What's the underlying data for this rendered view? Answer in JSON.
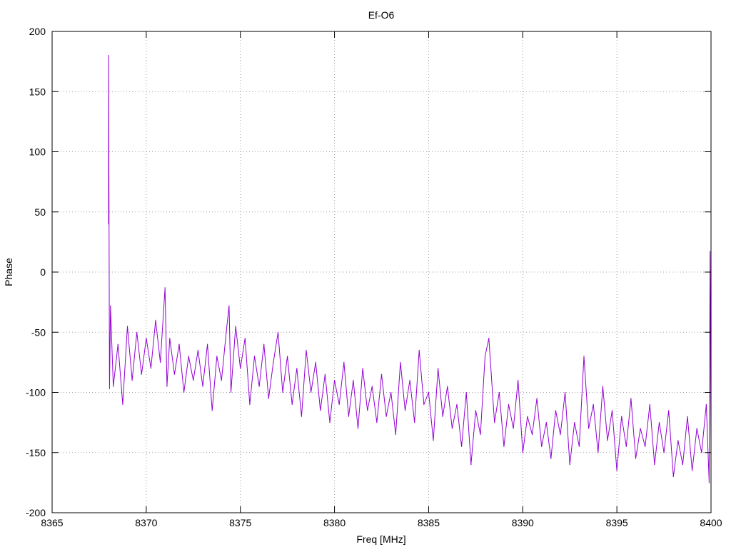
{
  "chart_data": {
    "type": "line",
    "title": "Ef-O6",
    "xlabel": "Freq [MHz]",
    "ylabel": "Phase",
    "xlim": [
      8365,
      8400
    ],
    "ylim": [
      -200,
      200
    ],
    "xticks": [
      8365,
      8370,
      8375,
      8380,
      8385,
      8390,
      8395,
      8400
    ],
    "yticks": [
      -200,
      -150,
      -100,
      -50,
      0,
      50,
      100,
      150,
      200
    ],
    "grid": true,
    "legend": "none",
    "series": [
      {
        "color": "#9400d3",
        "note_sampling": "approximate envelope of the noisy phase trace, sampled every 0.25 MHz",
        "x": [
          8368.0,
          8368.0,
          8368.05,
          8368.1,
          8368.25,
          8368.5,
          8368.75,
          8369.0,
          8369.25,
          8369.5,
          8369.75,
          8370.0,
          8370.25,
          8370.5,
          8370.75,
          8371.0,
          8371.1,
          8371.25,
          8371.5,
          8371.75,
          8372.0,
          8372.25,
          8372.5,
          8372.75,
          8373.0,
          8373.25,
          8373.5,
          8373.75,
          8374.0,
          8374.25,
          8374.4,
          8374.5,
          8374.75,
          8375.0,
          8375.25,
          8375.5,
          8375.75,
          8376.0,
          8376.25,
          8376.5,
          8376.75,
          8377.0,
          8377.25,
          8377.5,
          8377.75,
          8378.0,
          8378.25,
          8378.5,
          8378.75,
          8379.0,
          8379.25,
          8379.5,
          8379.75,
          8380.0,
          8380.25,
          8380.5,
          8380.75,
          8381.0,
          8381.25,
          8381.5,
          8381.75,
          8382.0,
          8382.25,
          8382.5,
          8382.75,
          8383.0,
          8383.25,
          8383.5,
          8383.75,
          8384.0,
          8384.25,
          8384.5,
          8384.75,
          8385.0,
          8385.25,
          8385.5,
          8385.75,
          8386.0,
          8386.25,
          8386.5,
          8386.75,
          8387.0,
          8387.25,
          8387.5,
          8387.75,
          8388.0,
          8388.2,
          8388.5,
          8388.75,
          8389.0,
          8389.25,
          8389.5,
          8389.75,
          8390.0,
          8390.25,
          8390.5,
          8390.75,
          8391.0,
          8391.25,
          8391.5,
          8391.75,
          8392.0,
          8392.25,
          8392.5,
          8392.75,
          8393.0,
          8393.25,
          8393.5,
          8393.75,
          8394.0,
          8394.25,
          8394.5,
          8394.75,
          8395.0,
          8395.25,
          8395.5,
          8395.75,
          8396.0,
          8396.25,
          8396.5,
          8396.75,
          8397.0,
          8397.25,
          8397.5,
          8397.75,
          8398.0,
          8398.25,
          8398.5,
          8398.75,
          8399.0,
          8399.25,
          8399.5,
          8399.75,
          8399.9,
          8399.95,
          8400.0
        ],
        "y": [
          40,
          180,
          -97,
          -28,
          -95,
          -60,
          -110,
          -45,
          -90,
          -50,
          -85,
          -55,
          -80,
          -40,
          -75,
          -13,
          -95,
          -55,
          -85,
          -60,
          -100,
          -70,
          -90,
          -65,
          -95,
          -60,
          -115,
          -70,
          -90,
          -50,
          -28,
          -100,
          -45,
          -80,
          -55,
          -110,
          -70,
          -95,
          -60,
          -105,
          -75,
          -50,
          -100,
          -70,
          -110,
          -80,
          -120,
          -65,
          -100,
          -75,
          -115,
          -85,
          -125,
          -90,
          -110,
          -75,
          -120,
          -90,
          -130,
          -80,
          -115,
          -95,
          -125,
          -85,
          -120,
          -100,
          -135,
          -75,
          -115,
          -90,
          -125,
          -65,
          -110,
          -100,
          -140,
          -80,
          -120,
          -95,
          -130,
          -110,
          -145,
          -100,
          -160,
          -115,
          -135,
          -70,
          -55,
          -125,
          -100,
          -145,
          -110,
          -130,
          -90,
          -150,
          -120,
          -135,
          -105,
          -145,
          -125,
          -155,
          -115,
          -135,
          -100,
          -160,
          -125,
          -145,
          -70,
          -130,
          -110,
          -150,
          -95,
          -140,
          -115,
          -165,
          -120,
          -145,
          -105,
          -155,
          -130,
          -145,
          -110,
          -160,
          -125,
          -150,
          -115,
          -170,
          -140,
          -160,
          -120,
          -165,
          -130,
          -150,
          -110,
          -175,
          17,
          -145
        ]
      }
    ]
  }
}
